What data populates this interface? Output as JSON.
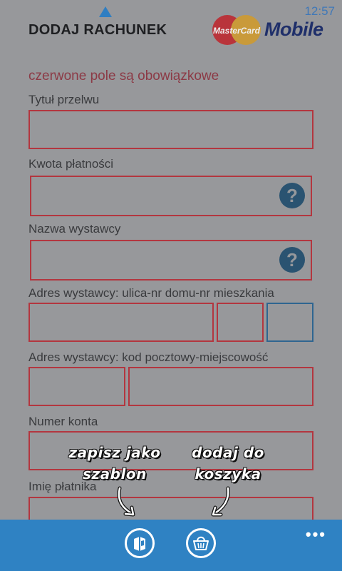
{
  "status": {
    "time": "12:57"
  },
  "header": {
    "title": "DODAJ RACHUNEK",
    "logo_badge": "MasterCard",
    "logo_text": "Mobile"
  },
  "form": {
    "required_note": "czerwone pole są obowiązkowe",
    "labels": {
      "title": "Tytuł przelwu",
      "amount": "Kwota płatności",
      "issuer_name": "Nazwa wystawcy",
      "issuer_address": "Adres wystawcy: ulica-nr domu-nr mieszkania",
      "issuer_postal": "Adres wystawcy: kod pocztowy-miejscowość",
      "account": "Numer konta",
      "payer_name": "Imię płatnika"
    },
    "help_glyph": "?"
  },
  "tips": {
    "save_template": "zapisz jako szablon",
    "add_to_cart": "dodaj do koszyka"
  },
  "appbar": {
    "more": "•••",
    "buttons": [
      "save-template-icon",
      "basket-icon"
    ]
  },
  "colors": {
    "accent": "#2f82c3",
    "required_border": "#b3363f",
    "background": "#97989b"
  }
}
